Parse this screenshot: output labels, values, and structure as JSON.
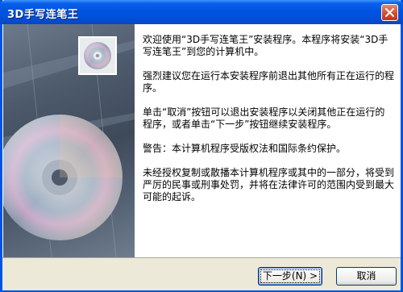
{
  "window": {
    "title": "3D手写连笔王"
  },
  "content": {
    "p1": "欢迎使用“3D手写连笔王”安装程序。本程序将安装“3D手写连笔王”到您的计算机中。",
    "p2": "强烈建议您在运行本安装程序前退出其他所有正在运行的程序。",
    "p3": "单击“取消”按钮可以退出安装程序以关闭其他正在运行的程序，或者单击“下一步”按钮继续安装程序。",
    "p4": "警告：本计算机程序受版权法和国际条约保护。",
    "p5": "未经授权复制或散播本计算机程序或其中的一部分，将受到严厉的民事或刑事处罚，并将在法律许可的范围内受到最大可能的起诉。"
  },
  "buttons": {
    "next": "下一步(N) >",
    "cancel": "取消"
  },
  "icons": {
    "close": "close-icon",
    "cd": "cd-icon"
  }
}
